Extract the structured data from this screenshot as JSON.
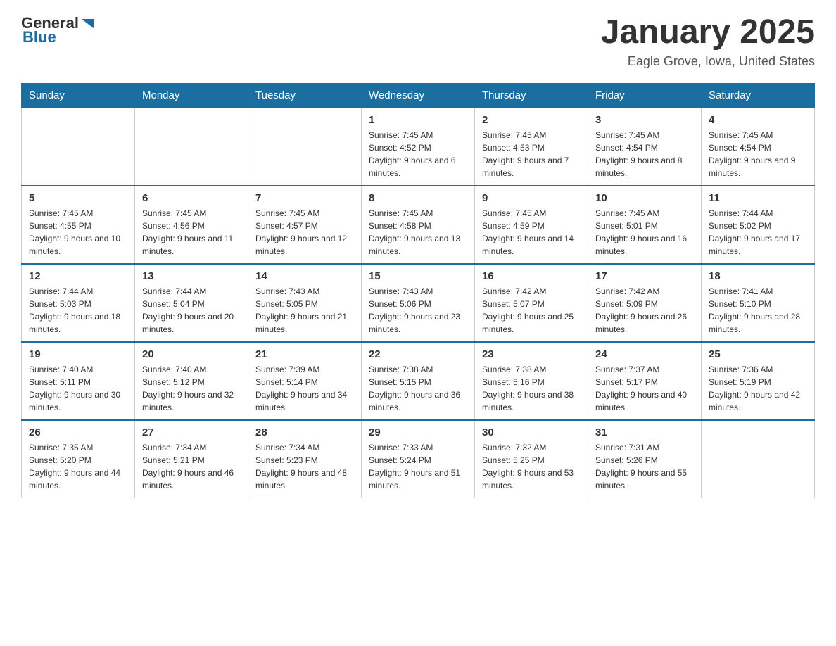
{
  "header": {
    "logo_general": "General",
    "logo_blue": "Blue",
    "title": "January 2025",
    "location": "Eagle Grove, Iowa, United States"
  },
  "days_of_week": [
    "Sunday",
    "Monday",
    "Tuesday",
    "Wednesday",
    "Thursday",
    "Friday",
    "Saturday"
  ],
  "weeks": [
    [
      {
        "day": "",
        "info": ""
      },
      {
        "day": "",
        "info": ""
      },
      {
        "day": "",
        "info": ""
      },
      {
        "day": "1",
        "info": "Sunrise: 7:45 AM\nSunset: 4:52 PM\nDaylight: 9 hours and 6 minutes."
      },
      {
        "day": "2",
        "info": "Sunrise: 7:45 AM\nSunset: 4:53 PM\nDaylight: 9 hours and 7 minutes."
      },
      {
        "day": "3",
        "info": "Sunrise: 7:45 AM\nSunset: 4:54 PM\nDaylight: 9 hours and 8 minutes."
      },
      {
        "day": "4",
        "info": "Sunrise: 7:45 AM\nSunset: 4:54 PM\nDaylight: 9 hours and 9 minutes."
      }
    ],
    [
      {
        "day": "5",
        "info": "Sunrise: 7:45 AM\nSunset: 4:55 PM\nDaylight: 9 hours and 10 minutes."
      },
      {
        "day": "6",
        "info": "Sunrise: 7:45 AM\nSunset: 4:56 PM\nDaylight: 9 hours and 11 minutes."
      },
      {
        "day": "7",
        "info": "Sunrise: 7:45 AM\nSunset: 4:57 PM\nDaylight: 9 hours and 12 minutes."
      },
      {
        "day": "8",
        "info": "Sunrise: 7:45 AM\nSunset: 4:58 PM\nDaylight: 9 hours and 13 minutes."
      },
      {
        "day": "9",
        "info": "Sunrise: 7:45 AM\nSunset: 4:59 PM\nDaylight: 9 hours and 14 minutes."
      },
      {
        "day": "10",
        "info": "Sunrise: 7:45 AM\nSunset: 5:01 PM\nDaylight: 9 hours and 16 minutes."
      },
      {
        "day": "11",
        "info": "Sunrise: 7:44 AM\nSunset: 5:02 PM\nDaylight: 9 hours and 17 minutes."
      }
    ],
    [
      {
        "day": "12",
        "info": "Sunrise: 7:44 AM\nSunset: 5:03 PM\nDaylight: 9 hours and 18 minutes."
      },
      {
        "day": "13",
        "info": "Sunrise: 7:44 AM\nSunset: 5:04 PM\nDaylight: 9 hours and 20 minutes."
      },
      {
        "day": "14",
        "info": "Sunrise: 7:43 AM\nSunset: 5:05 PM\nDaylight: 9 hours and 21 minutes."
      },
      {
        "day": "15",
        "info": "Sunrise: 7:43 AM\nSunset: 5:06 PM\nDaylight: 9 hours and 23 minutes."
      },
      {
        "day": "16",
        "info": "Sunrise: 7:42 AM\nSunset: 5:07 PM\nDaylight: 9 hours and 25 minutes."
      },
      {
        "day": "17",
        "info": "Sunrise: 7:42 AM\nSunset: 5:09 PM\nDaylight: 9 hours and 26 minutes."
      },
      {
        "day": "18",
        "info": "Sunrise: 7:41 AM\nSunset: 5:10 PM\nDaylight: 9 hours and 28 minutes."
      }
    ],
    [
      {
        "day": "19",
        "info": "Sunrise: 7:40 AM\nSunset: 5:11 PM\nDaylight: 9 hours and 30 minutes."
      },
      {
        "day": "20",
        "info": "Sunrise: 7:40 AM\nSunset: 5:12 PM\nDaylight: 9 hours and 32 minutes."
      },
      {
        "day": "21",
        "info": "Sunrise: 7:39 AM\nSunset: 5:14 PM\nDaylight: 9 hours and 34 minutes."
      },
      {
        "day": "22",
        "info": "Sunrise: 7:38 AM\nSunset: 5:15 PM\nDaylight: 9 hours and 36 minutes."
      },
      {
        "day": "23",
        "info": "Sunrise: 7:38 AM\nSunset: 5:16 PM\nDaylight: 9 hours and 38 minutes."
      },
      {
        "day": "24",
        "info": "Sunrise: 7:37 AM\nSunset: 5:17 PM\nDaylight: 9 hours and 40 minutes."
      },
      {
        "day": "25",
        "info": "Sunrise: 7:36 AM\nSunset: 5:19 PM\nDaylight: 9 hours and 42 minutes."
      }
    ],
    [
      {
        "day": "26",
        "info": "Sunrise: 7:35 AM\nSunset: 5:20 PM\nDaylight: 9 hours and 44 minutes."
      },
      {
        "day": "27",
        "info": "Sunrise: 7:34 AM\nSunset: 5:21 PM\nDaylight: 9 hours and 46 minutes."
      },
      {
        "day": "28",
        "info": "Sunrise: 7:34 AM\nSunset: 5:23 PM\nDaylight: 9 hours and 48 minutes."
      },
      {
        "day": "29",
        "info": "Sunrise: 7:33 AM\nSunset: 5:24 PM\nDaylight: 9 hours and 51 minutes."
      },
      {
        "day": "30",
        "info": "Sunrise: 7:32 AM\nSunset: 5:25 PM\nDaylight: 9 hours and 53 minutes."
      },
      {
        "day": "31",
        "info": "Sunrise: 7:31 AM\nSunset: 5:26 PM\nDaylight: 9 hours and 55 minutes."
      },
      {
        "day": "",
        "info": ""
      }
    ]
  ]
}
